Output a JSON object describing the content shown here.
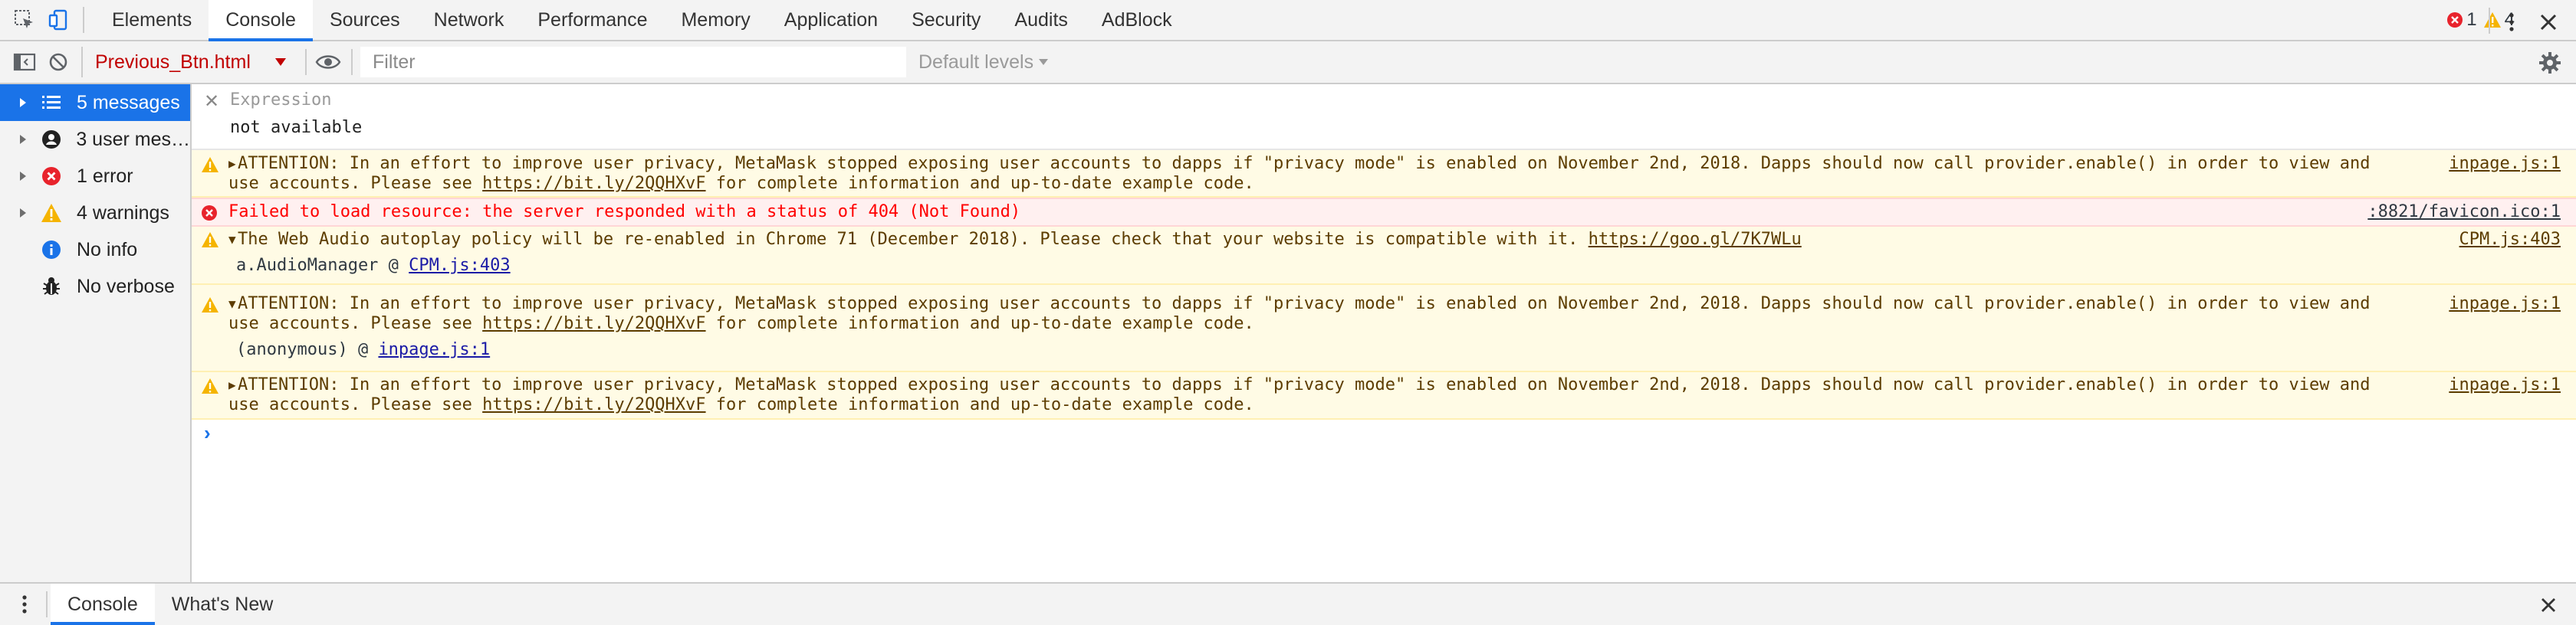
{
  "main_tabs": [
    {
      "label": "Elements"
    },
    {
      "label": "Console"
    },
    {
      "label": "Sources"
    },
    {
      "label": "Network"
    },
    {
      "label": "Performance"
    },
    {
      "label": "Memory"
    },
    {
      "label": "Application"
    },
    {
      "label": "Security"
    },
    {
      "label": "Audits"
    },
    {
      "label": "AdBlock"
    }
  ],
  "active_tab": "Console",
  "counts": {
    "errors": "1",
    "warnings": "4"
  },
  "toolbar": {
    "context": "Previous_Btn.html",
    "filter_placeholder": "Filter",
    "levels": "Default levels"
  },
  "sidebar": {
    "items": [
      {
        "label": "5 messages",
        "icon": "list-icon"
      },
      {
        "label": "3 user mes…",
        "icon": "user-icon"
      },
      {
        "label": "1 error",
        "icon": "error-icon"
      },
      {
        "label": "4 warnings",
        "icon": "warning-icon"
      },
      {
        "label": "No info",
        "icon": "info-icon"
      },
      {
        "label": "No verbose",
        "icon": "bug-icon"
      }
    ]
  },
  "expression": {
    "label": "Expression",
    "value": "not available"
  },
  "messages": [
    {
      "level": "warning",
      "text1": "ATTENTION: In an effort to improve user privacy, MetaMask stopped exposing user accounts to dapps if \"privacy mode\" is enabled on November 2nd, 2018. Dapps should now call provider.enable() in order to view and use accounts. Please see ",
      "link": "https://bit.ly/2QQHXvF",
      "text2": " for complete information and up-to-date example code.",
      "source": "inpage.js:1"
    },
    {
      "level": "error",
      "text1": "Failed to load resource: the server responded with a status of 404 (Not Found)",
      "source": ":8821/favicon.ico:1"
    },
    {
      "level": "warning",
      "text1": "The Web Audio autoplay policy will be re-enabled in Chrome 71 (December 2018). Please check that your website is compatible with it. ",
      "link": "https://goo.gl/7K7WLu",
      "source": "CPM.js:403",
      "stack_prefix": "a.AudioManager @ ",
      "stack_link": "CPM.js:403"
    },
    {
      "level": "warning",
      "text1": "ATTENTION: In an effort to improve user privacy, MetaMask stopped exposing user accounts to dapps if \"privacy mode\" is enabled on November 2nd, 2018. Dapps should now call provider.enable() in order to view and use accounts. Please see ",
      "link": "https://bit.ly/2QQHXvF",
      "text2": " for complete information and up-to-date example code.",
      "source": "inpage.js:1",
      "stack_prefix": "(anonymous) @ ",
      "stack_link": "inpage.js:1"
    },
    {
      "level": "warning",
      "text1": "ATTENTION: In an effort to improve user privacy, MetaMask stopped exposing user accounts to dapps if \"privacy mode\" is enabled on November 2nd, 2018. Dapps should now call provider.enable() in order to view and use accounts. Please see ",
      "link": "https://bit.ly/2QQHXvF",
      "text2": " for complete information and up-to-date example code.",
      "source": "inpage.js:1"
    }
  ],
  "prompt": "›",
  "drawer_tabs": [
    {
      "label": "Console"
    },
    {
      "label": "What's New"
    }
  ],
  "colors": {
    "accent": "#1a73e8",
    "error": "#ff0000",
    "warning": "#f5b400",
    "warning_bg": "#fffbe5",
    "error_bg": "#fff0f0"
  }
}
